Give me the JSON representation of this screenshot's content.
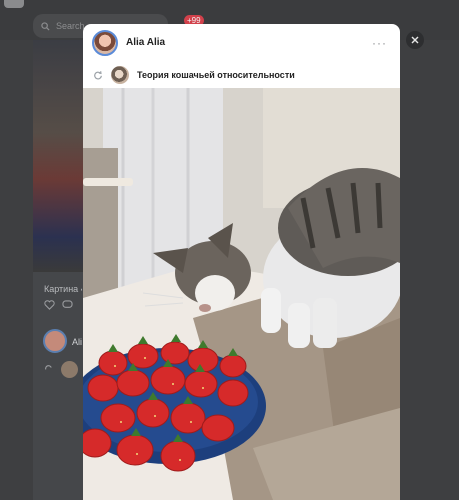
{
  "background": {
    "search_placeholder": "Search",
    "notifications_badge": "+99",
    "feed_caption": "Картина «",
    "feed_author_partial": "Ali"
  },
  "modal": {
    "author_name": "Alia Alia",
    "repost_group": "Теория кошачьей относительности",
    "icons": {
      "more": "more-horizontal-icon",
      "repost": "repost-icon",
      "close": "close-icon"
    }
  },
  "colors": {
    "overlay": "#0b0c0d",
    "modal_bg": "#ffffff",
    "avatar_ring": "#5b8bd8",
    "badge": "#d2414b"
  }
}
